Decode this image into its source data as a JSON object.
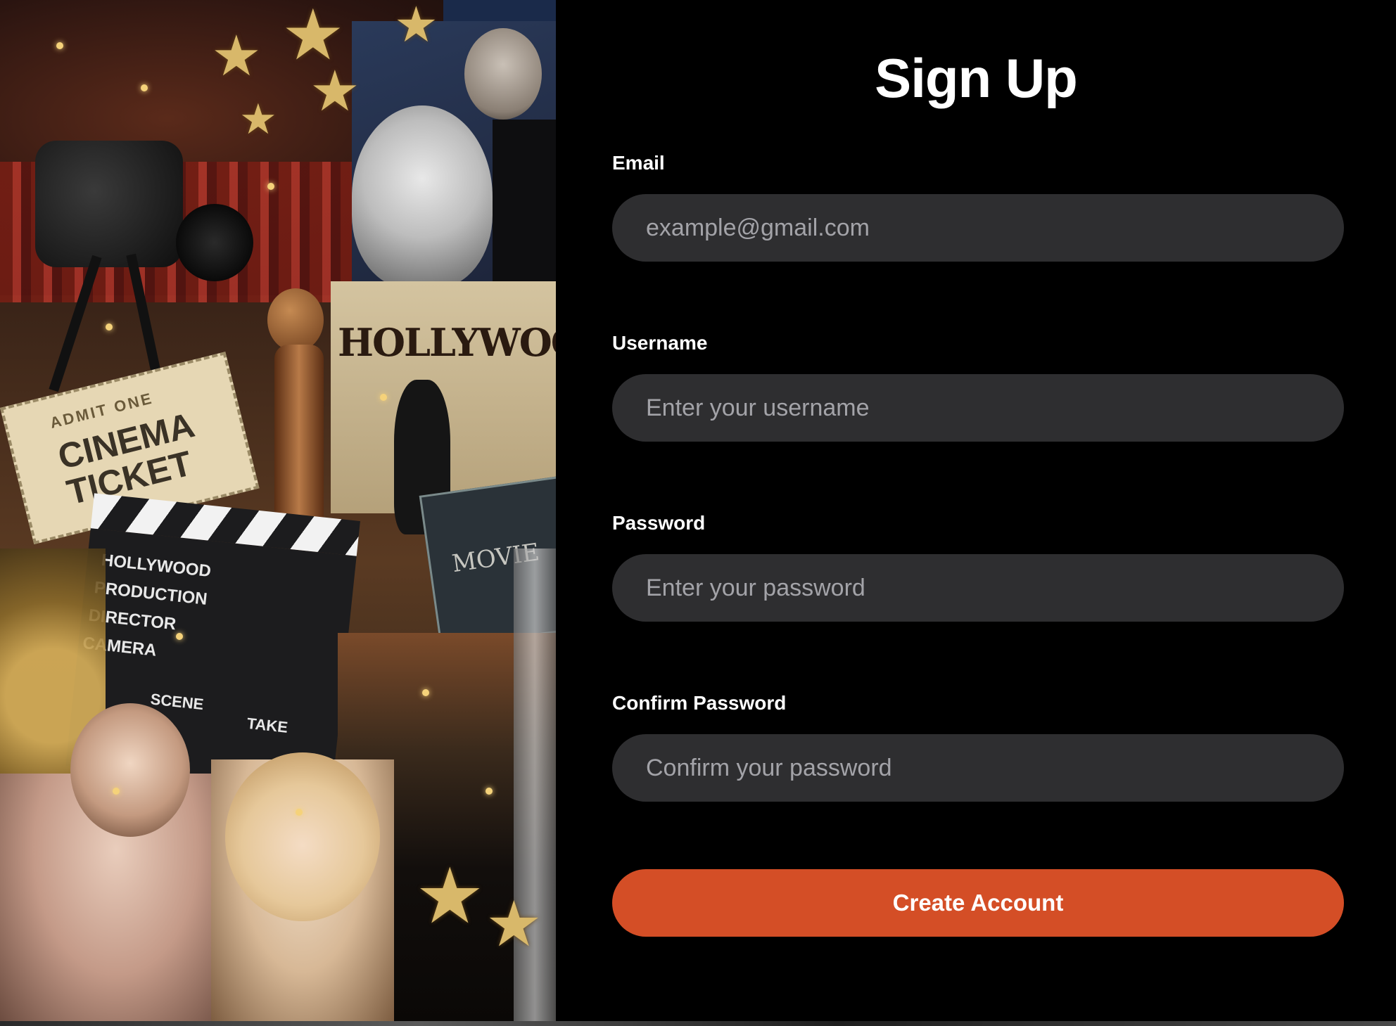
{
  "form": {
    "title": "Sign Up",
    "email": {
      "label": "Email",
      "placeholder": "example@gmail.com"
    },
    "username": {
      "label": "Username",
      "placeholder": "Enter your username"
    },
    "password": {
      "label": "Password",
      "placeholder": "Enter your password"
    },
    "confirm_password": {
      "label": "Confirm Password",
      "placeholder": "Confirm your password"
    },
    "submit_label": "Create Account"
  },
  "collage": {
    "hollywood_text": "HOLLYWOOD",
    "ticket_line1": "ADMIT ONE",
    "ticket_line2": "CINEMA",
    "ticket_line3": "TICKET",
    "clapper_lines": [
      "HOLLYWOOD",
      "PRODUCTION",
      "DIRECTOR",
      "CAMERA"
    ],
    "clapper_scene": "SCENE",
    "clapper_take": "TAKE",
    "movie_card": "MOVIE"
  },
  "colors": {
    "background": "#000000",
    "input_bg": "#2e2e30",
    "accent": "#d44e26"
  }
}
